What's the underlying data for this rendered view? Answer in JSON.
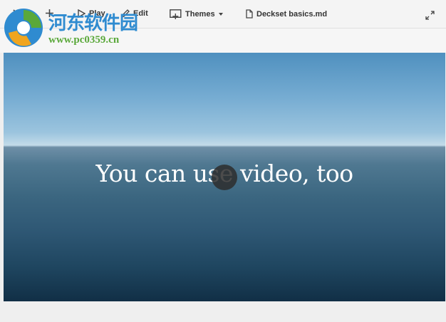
{
  "toolbar": {
    "play_label": "Play",
    "edit_label": "Edit",
    "themes_label": "Themes",
    "document_name": "Deckset basics.md"
  },
  "icons": {
    "close": "close-icon",
    "add": "plus-icon",
    "play": "play-icon",
    "edit": "pencil-icon",
    "themes": "themes-icon",
    "dropdown": "caret-down-icon",
    "document": "document-icon",
    "fullscreen": "expand-icon",
    "video_play": "play-overlay-icon"
  },
  "slide": {
    "title": "You can use video, too"
  },
  "watermark": {
    "title": "河东软件园",
    "url": "www.pc0359.cn"
  },
  "colors": {
    "watermark_blue": "#2f8bd0",
    "watermark_green": "#5aa83a",
    "sky": "#76acd2",
    "sea": "#2e5774"
  }
}
